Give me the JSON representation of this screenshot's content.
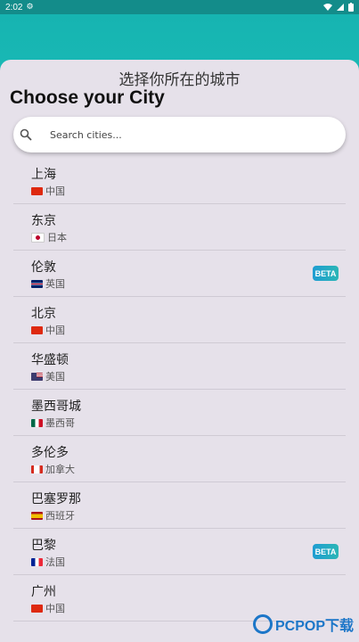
{
  "status_bar": {
    "time": "2:02"
  },
  "header": {
    "subtitle": "选择你所在的城市",
    "title": "Choose your City"
  },
  "search": {
    "placeholder": "Search cities..."
  },
  "cities": [
    {
      "name": "上海",
      "country": "中国",
      "flag": "cn",
      "beta": false
    },
    {
      "name": "东京",
      "country": "日本",
      "flag": "jp",
      "beta": false
    },
    {
      "name": "伦敦",
      "country": "英国",
      "flag": "gb",
      "beta": true
    },
    {
      "name": "北京",
      "country": "中国",
      "flag": "cn",
      "beta": false
    },
    {
      "name": "华盛顿",
      "country": "美国",
      "flag": "us",
      "beta": false
    },
    {
      "name": "墨西哥城",
      "country": "墨西哥",
      "flag": "mx",
      "beta": false
    },
    {
      "name": "多伦多",
      "country": "加拿大",
      "flag": "ca",
      "beta": false
    },
    {
      "name": "巴塞罗那",
      "country": "西班牙",
      "flag": "es",
      "beta": false
    },
    {
      "name": "巴黎",
      "country": "法国",
      "flag": "fr",
      "beta": true
    },
    {
      "name": "广州",
      "country": "中国",
      "flag": "cn",
      "beta": false
    }
  ],
  "badge_label": "BETA",
  "watermark": {
    "text": "PCPOP下载"
  },
  "colors": {
    "teal": "#1fc8c2",
    "sheet": "#e6e1ea",
    "badge": "#1f9dd2"
  }
}
